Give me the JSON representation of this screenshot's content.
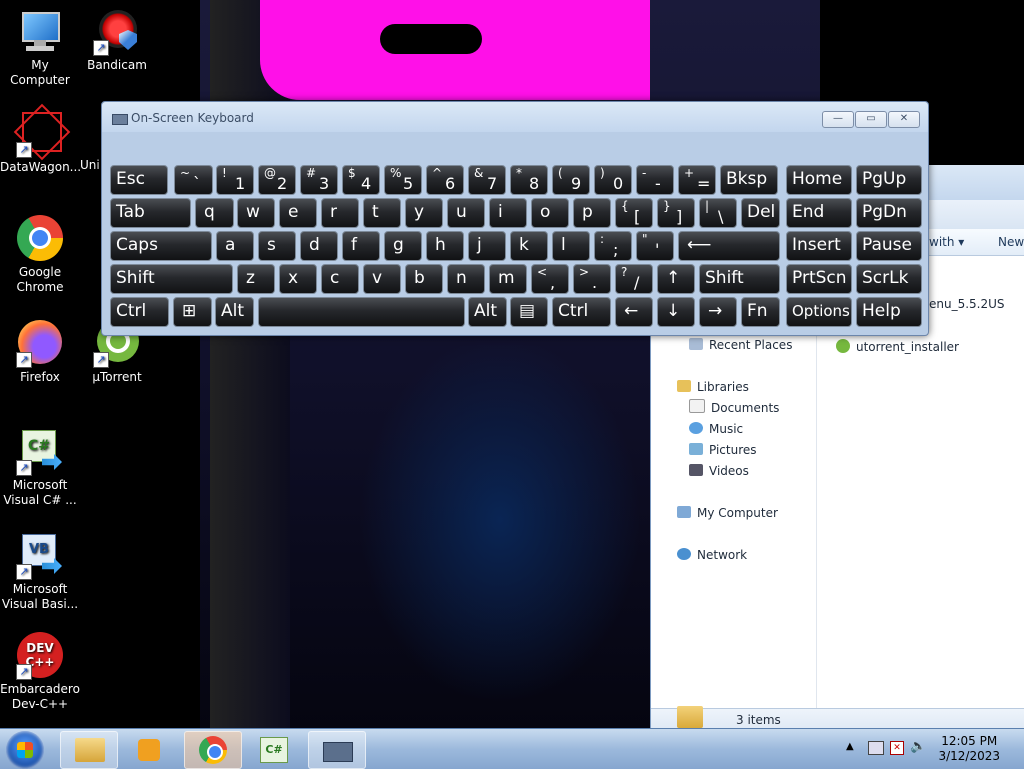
{
  "desktop": {
    "icons": [
      {
        "label": "My Computer"
      },
      {
        "label": "Bandicam"
      },
      {
        "label": "DataWagon..."
      },
      {
        "label": "Uni"
      },
      {
        "label": "Google Chrome"
      },
      {
        "label": "Firefox"
      },
      {
        "label": "μTorrent"
      },
      {
        "label": "Microsoft Visual C# ..."
      },
      {
        "label": "Microsoft Visual Basi..."
      },
      {
        "label": "Embarcadero Dev-C++"
      }
    ]
  },
  "osk": {
    "title": "On-Screen Keyboard",
    "rows": [
      [
        "Esc",
        "~ `",
        "! 1",
        "@ 2",
        "# 3",
        "$ 4",
        "% 5",
        "^ 6",
        "& 7",
        "* 8",
        "( 9",
        ") 0",
        "- -",
        "+ =",
        "Bksp",
        "Home",
        "PgUp"
      ],
      [
        "Tab",
        "q",
        "w",
        "e",
        "r",
        "t",
        "y",
        "u",
        "i",
        "o",
        "p",
        "{ [",
        "} ]",
        "| \\",
        "Del",
        "End",
        "PgDn"
      ],
      [
        "Caps",
        "a",
        "s",
        "d",
        "f",
        "g",
        "h",
        "j",
        "k",
        "l",
        ": ;",
        "\" '",
        "⟵",
        "Insert",
        "Pause"
      ],
      [
        "Shift",
        "z",
        "x",
        "c",
        "v",
        "b",
        "n",
        "m",
        "< ,",
        "> .",
        "? /",
        "↑",
        "Shift",
        "PrtScn",
        "ScrLk"
      ],
      [
        "Ctrl",
        "⊞",
        "Alt",
        "",
        "Alt",
        "▤",
        "Ctrl",
        "←",
        "↓",
        "→",
        "Fn",
        "Options",
        "Help"
      ]
    ]
  },
  "explorer": {
    "toolbar_with": "with ▾",
    "toolbar_new": "New",
    "nav": [
      "Recent Places",
      "Libraries",
      "Documents",
      "Music",
      "Pictures",
      "Videos",
      "My Computer",
      "Network"
    ],
    "files": [
      "enu_5.5.2US",
      "utorrent_installer"
    ],
    "status": "3 items"
  },
  "taskbar": {
    "time": "12:05 PM",
    "date": "3/12/2023"
  }
}
